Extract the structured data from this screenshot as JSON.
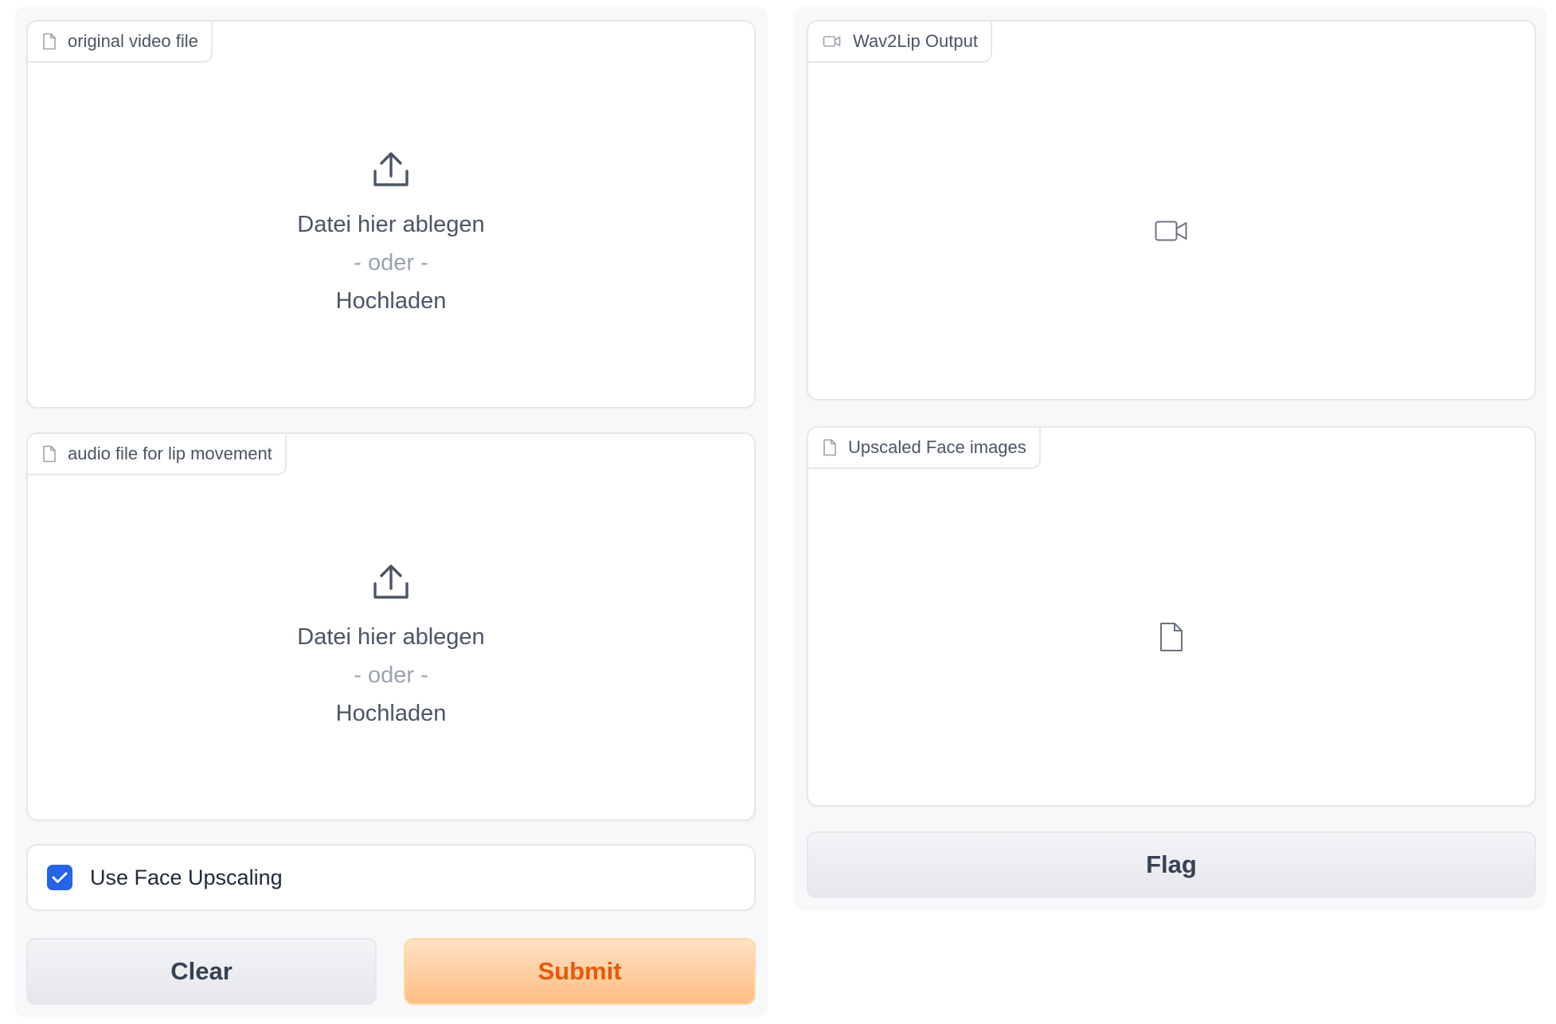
{
  "inputs": {
    "video": {
      "label": "original video file",
      "drop_text": "Datei hier ablegen",
      "or_text": "- oder -",
      "upload_text": "Hochladen"
    },
    "audio": {
      "label": "audio file for lip movement",
      "drop_text": "Datei hier ablegen",
      "or_text": "- oder -",
      "upload_text": "Hochladen"
    },
    "face_upscaling": {
      "label": "Use Face Upscaling",
      "checked": true
    }
  },
  "buttons": {
    "clear": "Clear",
    "submit": "Submit",
    "flag": "Flag"
  },
  "outputs": {
    "video": {
      "label": "Wav2Lip Output"
    },
    "images": {
      "label": "Upscaled Face images"
    }
  },
  "colors": {
    "accent": "#2563eb",
    "primary_text": "#ea580c",
    "primary_bg": "#fdbf82"
  }
}
